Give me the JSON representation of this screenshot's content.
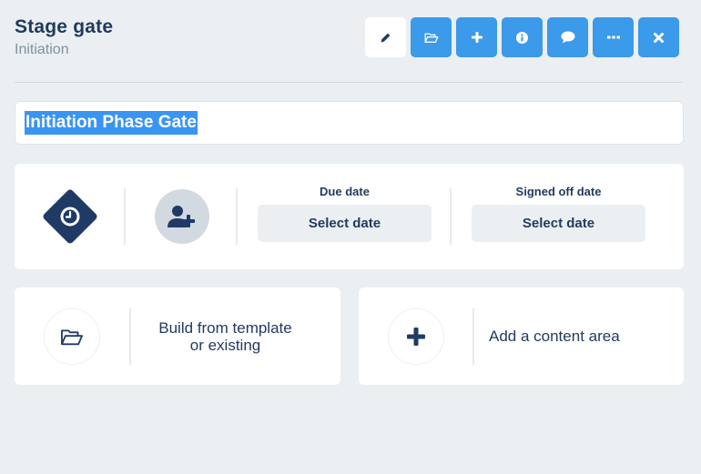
{
  "header": {
    "title": "Stage gate",
    "subtitle": "Initiation"
  },
  "toolbar": {
    "buttons": [
      {
        "name": "edit",
        "icon": "pencil-icon",
        "style": "white"
      },
      {
        "name": "open",
        "icon": "folder-open-icon",
        "style": "blue"
      },
      {
        "name": "add",
        "icon": "plus-icon",
        "style": "blue"
      },
      {
        "name": "info",
        "icon": "info-circle-icon",
        "style": "blue"
      },
      {
        "name": "comment",
        "icon": "comment-icon",
        "style": "blue"
      },
      {
        "name": "more",
        "icon": "ellipsis-icon",
        "style": "blue"
      },
      {
        "name": "close",
        "icon": "close-icon",
        "style": "blue"
      }
    ]
  },
  "title_field": {
    "value": "Initiation Phase Gate",
    "selected": true
  },
  "meta": {
    "status_icon": "clock-diamond-icon",
    "assign_icon": "user-plus-icon",
    "due_date": {
      "label": "Due date",
      "button": "Select date"
    },
    "signed_off_date": {
      "label": "Signed off date",
      "button": "Select date"
    }
  },
  "actions": [
    {
      "icon": "folder-open-icon",
      "line1": "Build from template",
      "line2": "or existing"
    },
    {
      "icon": "plus-icon",
      "label": "Add a content area"
    }
  ],
  "colors": {
    "background": "#ebeff1",
    "primary_blue": "#3b9ae9",
    "navy": "#1f3a5f",
    "selection": "#3994f3",
    "muted_text": "#7f8fa4"
  }
}
